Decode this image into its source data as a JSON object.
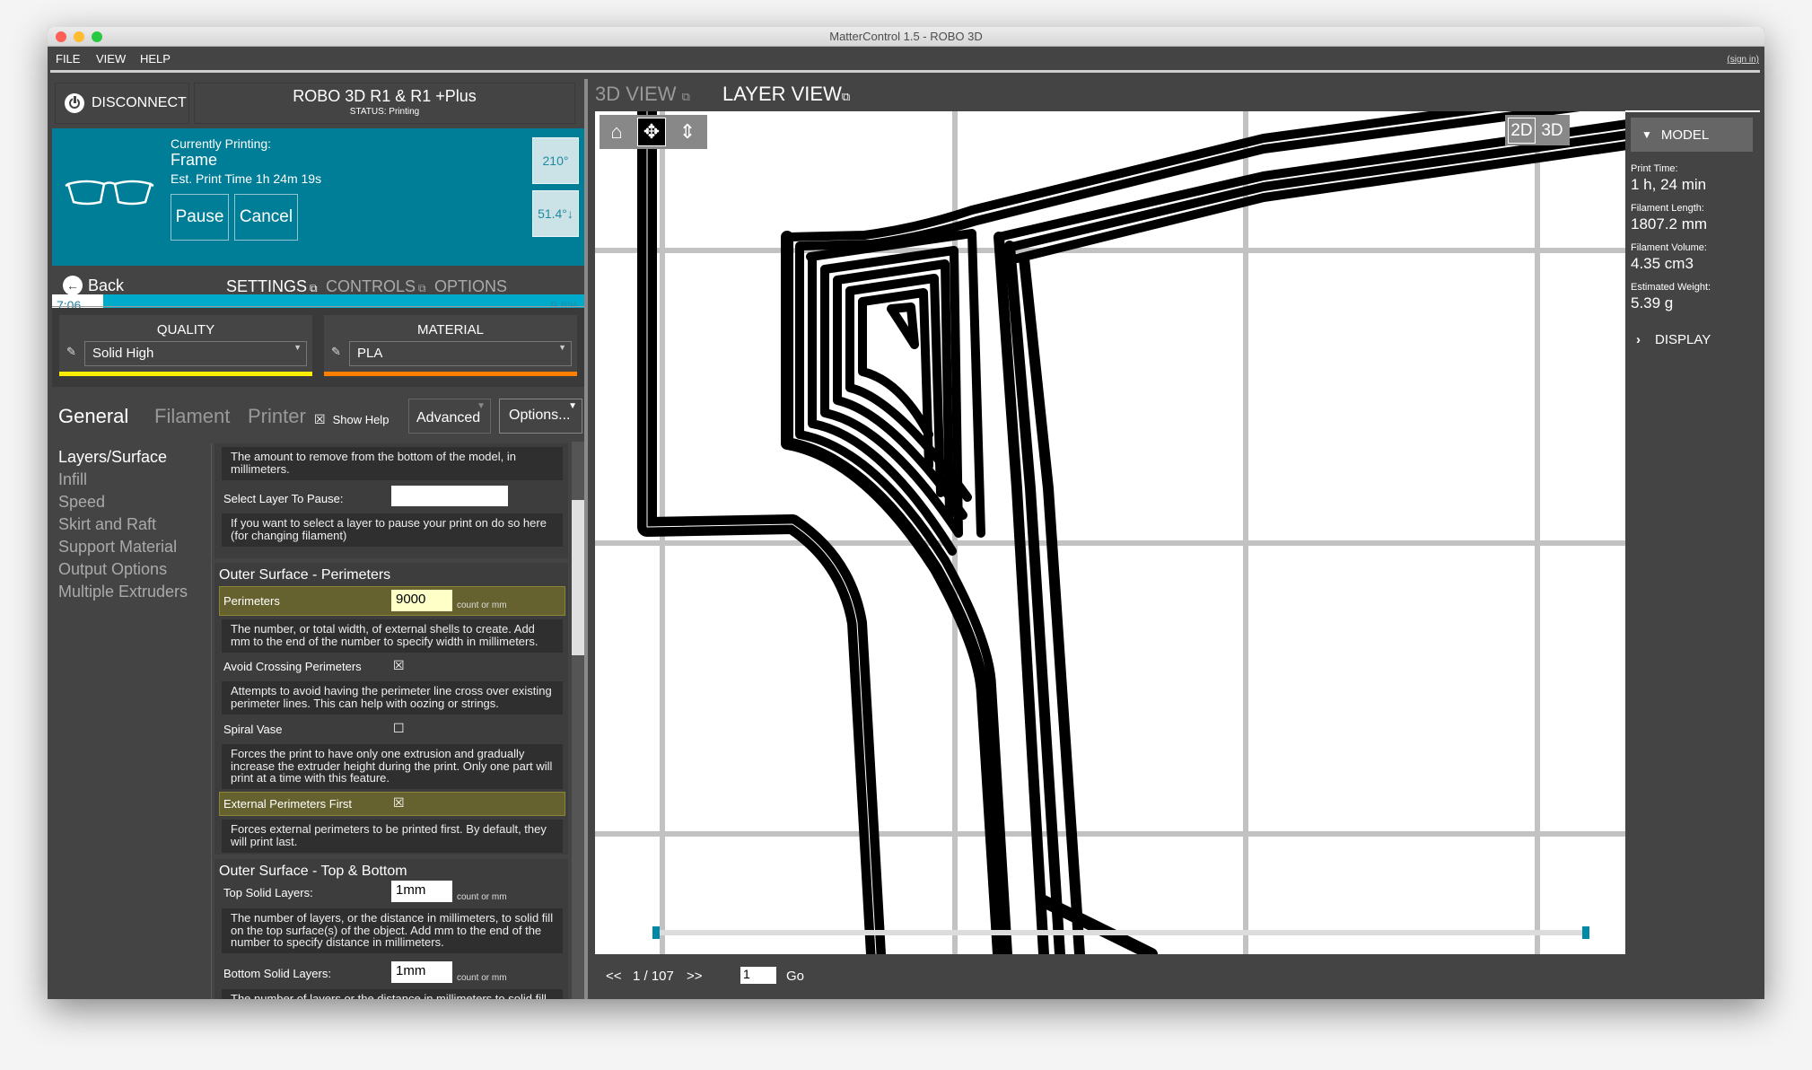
{
  "window": {
    "title": "MatterControl 1.5 - ROBO 3D"
  },
  "menu": {
    "items": [
      "FILE",
      "VIEW",
      "HELP"
    ],
    "sign_in": "(sign in)"
  },
  "printer": {
    "disconnect_label": "DISCONNECT",
    "name": "ROBO 3D R1 & R1 +Plus",
    "status": "STATUS: Printing"
  },
  "print": {
    "currently_label": "Currently Printing:",
    "name": "Frame",
    "est_time": "Est. Print Time 1h 24m 19s",
    "pause_label": "Pause",
    "cancel_label": "Cancel",
    "extruder_temp": "210°",
    "bed_temp": "51.4°↓",
    "elapsed": "7:06",
    "percent_label": "9.6%",
    "progress": 0.096
  },
  "nav": {
    "back_label": "Back",
    "tabs": [
      {
        "label": "SETTINGS",
        "active": true,
        "external": true
      },
      {
        "label": "CONTROLS",
        "active": false,
        "external": true
      },
      {
        "label": "OPTIONS",
        "active": false,
        "external": false
      }
    ]
  },
  "quality": {
    "title": "QUALITY",
    "value": "Solid High",
    "color": "#ffee00"
  },
  "material": {
    "title": "MATERIAL",
    "value": "PLA",
    "color": "#ff7f00"
  },
  "settings_tabs": {
    "tabs": [
      {
        "label": "General",
        "active": true
      },
      {
        "label": "Filament",
        "active": false
      },
      {
        "label": "Printer",
        "active": false
      }
    ],
    "show_help_label": "Show Help",
    "show_help_checked": true,
    "advanced_label": "Advanced",
    "options_label": "Options..."
  },
  "sidebar": {
    "items": [
      {
        "label": "Layers/Surface",
        "active": true
      },
      {
        "label": "Infill",
        "active": false
      },
      {
        "label": "Speed",
        "active": false
      },
      {
        "label": "Skirt and Raft",
        "active": false
      },
      {
        "label": "Support Material",
        "active": false
      },
      {
        "label": "Output Options",
        "active": false
      },
      {
        "label": "Multiple Extruders",
        "active": false
      }
    ]
  },
  "settings": {
    "bottom_clip_help": "The amount to remove from the bottom of the model, in millimeters.",
    "pause_layer_label": "Select Layer To Pause:",
    "pause_layer_value": "",
    "pause_layer_help": "If you want to select a layer to pause your print on do so here (for changing filament)",
    "perimeters_section": "Outer Surface - Perimeters",
    "perimeters_label": "Perimeters",
    "perimeters_value": "9000",
    "perimeters_unit": "count or mm",
    "perimeters_help": "The number, or total width, of external shells to create. Add mm to the end of the number to specify width in millimeters.",
    "avoid_crossing_label": "Avoid Crossing Perimeters",
    "avoid_crossing_checked": true,
    "avoid_crossing_help": "Attempts to avoid having the perimeter line cross over existing perimeter lines. This can help with oozing or strings.",
    "spiral_vase_label": "Spiral Vase",
    "spiral_vase_checked": false,
    "spiral_vase_help": "Forces the print to have only one extrusion and gradually increase the extruder height during the print. Only one part will print at a time with this feature.",
    "ext_perimeters_label": "External Perimeters First",
    "ext_perimeters_checked": true,
    "ext_perimeters_help": "Forces external perimeters to be printed first. By default, they will print last.",
    "top_bottom_section": "Outer Surface - Top & Bottom",
    "top_solid_label": "Top Solid Layers:",
    "top_solid_value": "1mm",
    "top_solid_unit": "count or mm",
    "top_solid_help": "The number of layers, or the distance in millimeters, to solid fill on the top surface(s) of the object. Add mm to the end of the number to specify distance in millimeters.",
    "bottom_solid_label": "Bottom Solid Layers:",
    "bottom_solid_value": "1mm",
    "bottom_solid_unit": "count or mm",
    "bottom_solid_help": "The number of layers or the distance in millimeters to solid fill on the bottom surface(s) of the object. Add mm to the end of the number to specify distance in millimeters."
  },
  "view_tabs": [
    {
      "label": "3D VIEW",
      "active": false
    },
    {
      "label": "LAYER VIEW",
      "active": true
    }
  ],
  "view_tools": {
    "tools": [
      "home-icon",
      "move-icon",
      "zoom-icon"
    ],
    "active_tool": "move-icon",
    "dim_2d": "2D",
    "dim_3d": "3D",
    "active_dim": "2D"
  },
  "model_panel": {
    "model_label": "MODEL",
    "stats": [
      {
        "label": "Print Time:",
        "value": "1 h, 24 min"
      },
      {
        "label": "Filament Length:",
        "value": "1807.2 mm"
      },
      {
        "label": "Filament Volume:",
        "value": "4.35 cm3"
      },
      {
        "label": "Estimated Weight:",
        "value": "5.39 g"
      }
    ],
    "display_label": "DISPLAY"
  },
  "layers": {
    "prev_label": "<<",
    "current_label": "1 / 107",
    "next_label": ">>",
    "current": 1,
    "total": 107,
    "go_input": "1",
    "go_label": "Go"
  },
  "colors": {
    "teal": "#007e97",
    "progress": "#00aacb",
    "highlight": "#66622f",
    "slider_handle": "#008aa5"
  }
}
